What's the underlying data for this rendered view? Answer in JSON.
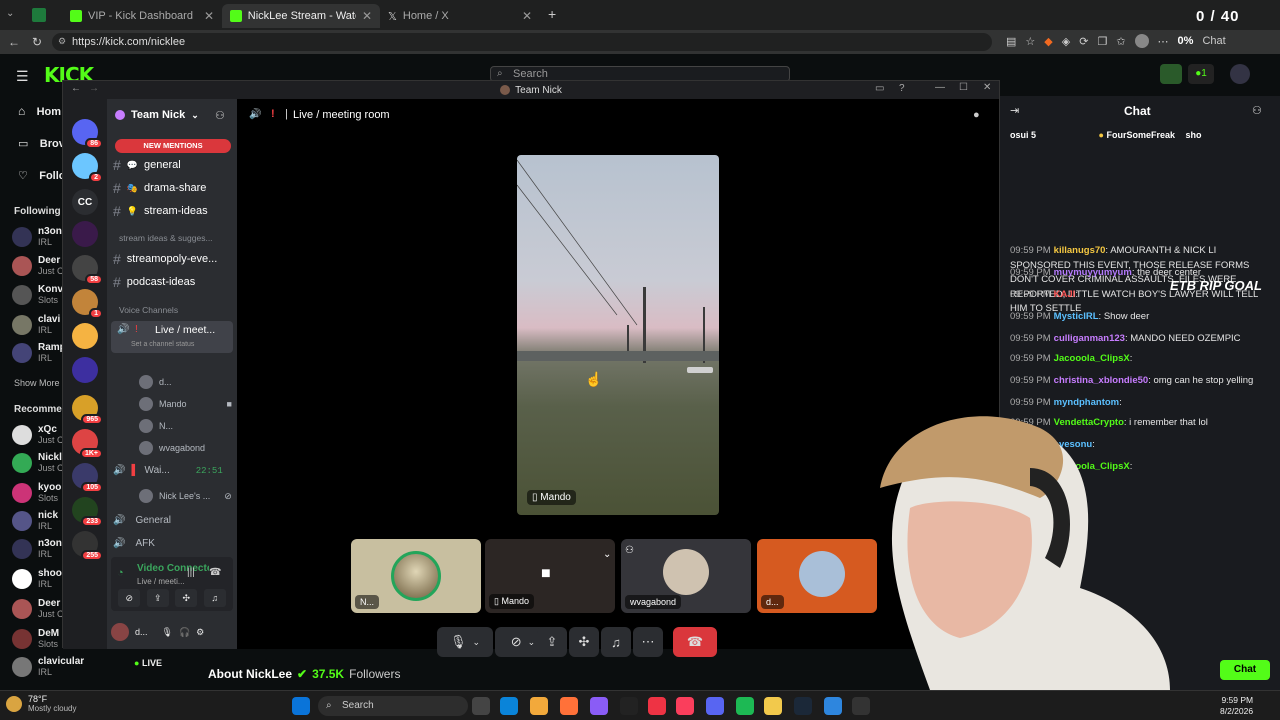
{
  "browser": {
    "tabs": [
      {
        "label": "VIP - Kick Dashboard"
      },
      {
        "label": "NickLee Stream - Watch Live on Ki"
      },
      {
        "label": "Home / X"
      }
    ],
    "url": "https://kick.com/nicklee",
    "counter": "0 / 40",
    "percent": "0%",
    "chat_label": "Chat"
  },
  "kick": {
    "search_placeholder": "Search",
    "nav": [
      {
        "label": "Hom"
      },
      {
        "label": "Brov"
      },
      {
        "label": "Follo"
      }
    ],
    "following_label": "Following",
    "following": [
      {
        "name": "n3on",
        "sub": "IRL"
      },
      {
        "name": "Deer",
        "sub": "Just C"
      },
      {
        "name": "Konv",
        "sub": "Slots"
      },
      {
        "name": "clavi",
        "sub": "IRL"
      },
      {
        "name": "Ramp",
        "sub": "IRL"
      }
    ],
    "show_more": "Show More",
    "recommended_label": "Recomme",
    "recommended": [
      {
        "name": "xQc",
        "sub": "Just C"
      },
      {
        "name": "Nickl",
        "sub": "Just C"
      },
      {
        "name": "kyoo",
        "sub": "Slots"
      },
      {
        "name": "nick",
        "sub": "IRL"
      },
      {
        "name": "n3on",
        "sub": "IRL"
      },
      {
        "name": "shoo",
        "sub": "IRL"
      },
      {
        "name": "Deer",
        "sub": "Just C"
      },
      {
        "name": "DeM",
        "sub": "Slots"
      },
      {
        "name": "clavicular",
        "sub": "IRL"
      }
    ],
    "live_label": "LIVE",
    "about": "About NickLee",
    "followers_count": "37.5K",
    "followers_label": "Followers",
    "chat_title": "Chat",
    "chat_button": "Chat",
    "goal_overlay": "ETB RIP GOAL"
  },
  "discord": {
    "window_title": "Team Nick",
    "server_name": "Team Nick",
    "new_mentions": "NEW MENTIONS",
    "channels": [
      {
        "label": "general"
      },
      {
        "label": "drama-share"
      },
      {
        "label": "stream-ideas"
      }
    ],
    "category": "stream ideas & sugges...",
    "channels2": [
      {
        "label": "streamopoly-eve..."
      },
      {
        "label": "podcast-ideas"
      }
    ],
    "voice_label": "Voice Channels",
    "voice_channel": "Live / meet...",
    "channel_status": "Set a channel status",
    "voice_users": [
      {
        "name": "d..."
      },
      {
        "name": "Mando"
      },
      {
        "name": "N..."
      },
      {
        "name": "wvagabond"
      }
    ],
    "wait_channel": "Wai...",
    "wait_time": "22:51",
    "wait_user": "Nick Lee's ...",
    "general_voice": "General",
    "afk": "AFK",
    "connected": "Video Connecte",
    "connected_sub": "Live / meeti...",
    "user_short": "d...",
    "call_header": "Live / meeting room",
    "main_label": "Mando",
    "tiles": [
      {
        "label": "N..."
      },
      {
        "label": "Mando"
      },
      {
        "label": "wvagabond"
      },
      {
        "label": "d..."
      }
    ],
    "server_badges": [
      "86",
      "2",
      "58",
      "1",
      "965",
      "1K+",
      "105",
      "233",
      "255"
    ],
    "server_cc": "CC"
  },
  "chat_messages": [
    {
      "time": "",
      "user": "osui 5",
      "text": "",
      "color": "#ffffff"
    },
    {
      "time": "09:59 PM",
      "user": "killanugs70",
      "text": "AMOURANTH & NICK LI SPONSORED THIS EVENT, THOSE RELEASE FORMS DON'T COVER CRIMINAL ASSAULTS, FILES WERE REPORTED, LITTLE WATCH BOY'S LAWYER WILL TELL HIM TO SETTLE",
      "color": "#f5c842"
    },
    {
      "time": "09:59 PM",
      "user": "muymuyyumyum",
      "text": "the deer center",
      "color": "#b57bff"
    },
    {
      "time": "09:59 PM",
      "user": "KAJI",
      "text": "",
      "color": "#ff5a5a"
    },
    {
      "time": "09:59 PM",
      "user": "MysticIRL",
      "text": "Show deer",
      "color": "#5bc0ff"
    },
    {
      "time": "09:59 PM",
      "user": "culliganman123",
      "text": "MANDO NEED OZEMPIC",
      "color": "#c77dff"
    },
    {
      "time": "09:59 PM",
      "user": "Jacooola_ClipsX",
      "text": "",
      "color": "#53fc18"
    },
    {
      "time": "09:59 PM",
      "user": "christina_xblondie50",
      "text": "omg can he stop yelling",
      "color": "#c77dff"
    },
    {
      "time": "09:59 PM",
      "user": "myndphantom",
      "text": "",
      "color": "#5bc0ff"
    },
    {
      "time": "09:59 PM",
      "user": "VendettaCrypto",
      "text": "i remember that lol",
      "color": "#53fc18"
    },
    {
      "time": "09:59 PM",
      "user": "eyesonu",
      "text": "",
      "color": "#5bc0ff"
    },
    {
      "time": "09:59 PM",
      "user": "Jacooola_ClipsX",
      "text": "",
      "color": "#53fc18"
    }
  ],
  "chat_top": {
    "gift_user": "FourSomeFreak",
    "extra": "sho"
  },
  "taskbar": {
    "weather_temp": "78°F",
    "weather_desc": "Mostly cloudy",
    "search": "Search",
    "time": "9:59 PM",
    "date": "8/2/2026"
  },
  "colors": {
    "kick_green": "#53fc18",
    "discord_red": "#da373c",
    "discord_blurple": "#5865f2"
  }
}
